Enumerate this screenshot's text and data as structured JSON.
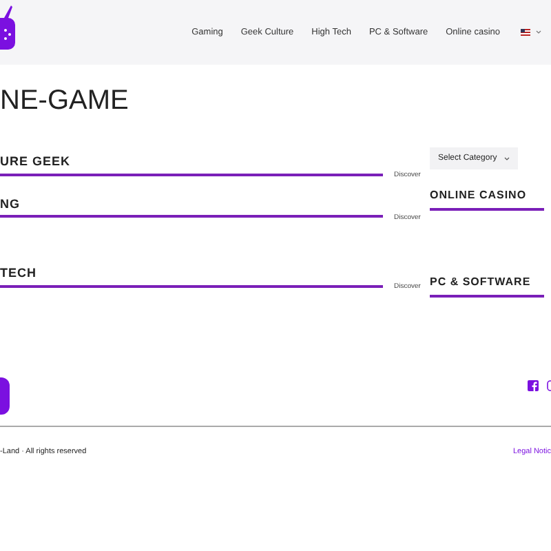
{
  "nav": {
    "items": [
      "Gaming",
      "Geek Culture",
      "High Tech",
      "PC & Software",
      "Online casino"
    ]
  },
  "title": "NE-GAME",
  "categories": [
    {
      "title": "URE GEEK",
      "link": "Discover"
    },
    {
      "title": "NG",
      "link": "Discover"
    },
    {
      "title": "TECH",
      "link": "Discover"
    }
  ],
  "sidebar": {
    "select": "Select Category",
    "widgets": [
      "ONLINE CASINO",
      "PC & SOFTWARE"
    ]
  },
  "footer": {
    "copyright": "-Land · All rights reserved",
    "legal_link": "Legal Notic"
  }
}
